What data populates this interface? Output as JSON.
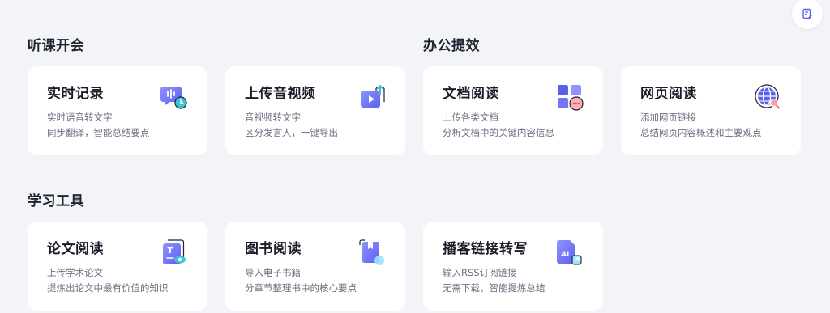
{
  "sections": {
    "listen": "听课开会",
    "office": "办公提效",
    "study": "学习工具"
  },
  "cards": {
    "realtime": {
      "title": "实时记录",
      "line1": "实时语音转文字",
      "line2": "同步翻译，智能总结要点",
      "icon": "mic-clock-icon"
    },
    "upload": {
      "title": "上传音视频",
      "line1": "音视频转文字",
      "line2": "区分发言人，一键导出",
      "icon": "video-upload-icon"
    },
    "docread": {
      "title": "文档阅读",
      "line1": "上传各类文档",
      "line2": "分析文档中的关键内容信息",
      "icon": "document-grid-icon"
    },
    "webread": {
      "title": "网页阅读",
      "line1": "添加网页链接",
      "line2": "总结网页内容概述和主要观点",
      "icon": "globe-search-icon"
    },
    "paper": {
      "title": "论文阅读",
      "line1": "上传学术论文",
      "line2": "提炼出论文中最有价值的知识",
      "icon": "paper-eye-icon"
    },
    "book": {
      "title": "图书阅读",
      "line1": "导入电子书籍",
      "line2": "分章节整理书中的核心要点",
      "icon": "book-icon"
    },
    "podcast": {
      "title": "播客链接转写",
      "line1": "输入RSS订阅链接",
      "line2": "无需下载，智能提炼总结",
      "icon": "ai-file-link-icon"
    }
  },
  "colors": {
    "accent": "#5b5ff0",
    "accent_light": "#8f93ff",
    "teal": "#3fc2d4"
  }
}
